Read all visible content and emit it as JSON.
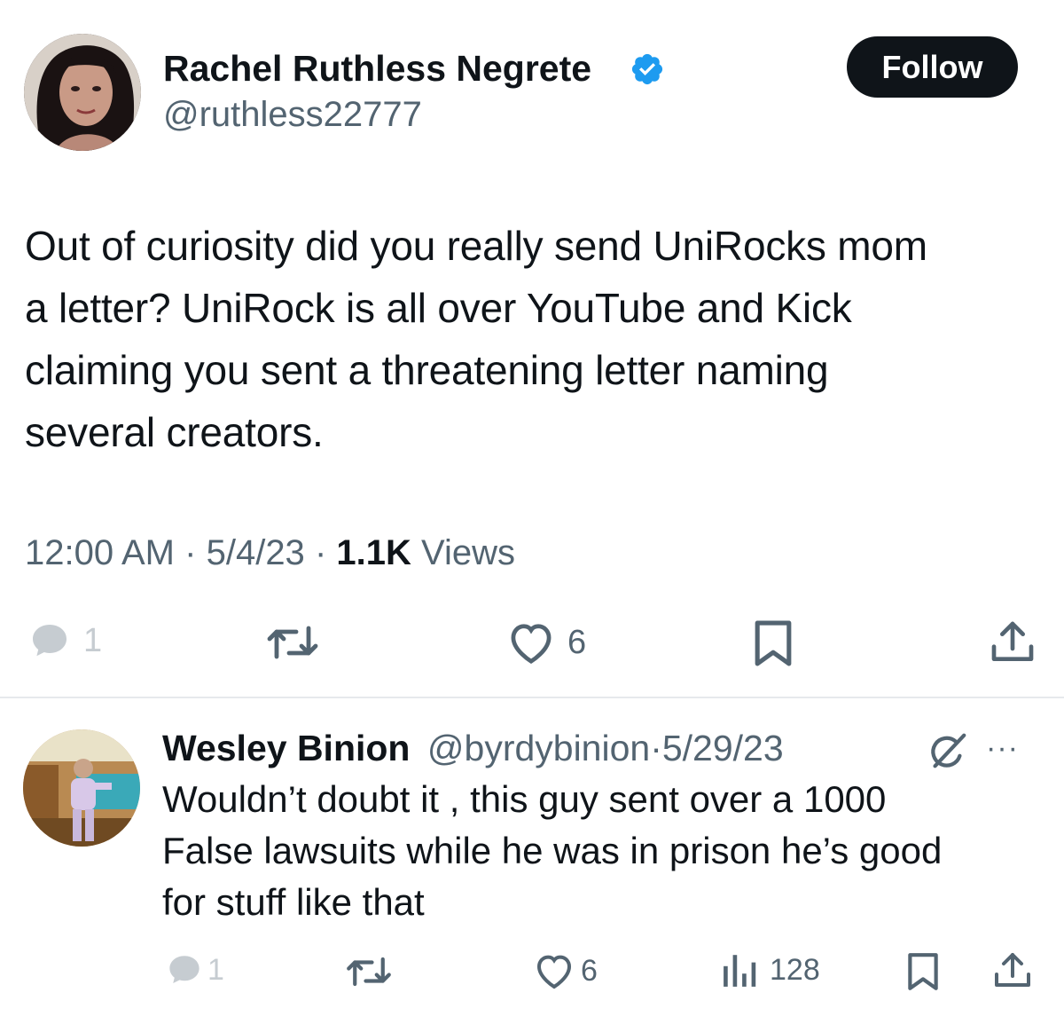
{
  "tweet": {
    "author_name": "Rachel Ruthless Negrete",
    "handle": "@ruthless22777",
    "follow_label": "Follow",
    "text_lines": [
      "Out of curiosity did you really send UniRocks mom",
      "a letter? UniRock is all over YouTube and Kick",
      "claiming you sent a threatening letter naming",
      "several creators."
    ],
    "time": "12:00 AM",
    "separator": "·",
    "date": "5/4/23",
    "views_count": "1.1K",
    "views_label": "Views",
    "replies": "1",
    "likes": "6"
  },
  "reply": {
    "author_name": "Wesley Binion",
    "handle": "@byrdybinion",
    "separator": "·",
    "date": "5/29/23",
    "more_label": "···",
    "text_lines": [
      "Wouldn’t doubt it , this guy sent over a 1000",
      "False lawsuits while he was in prison he’s good",
      "for stuff like that"
    ],
    "replies": "1",
    "likes": "6",
    "views": "128"
  },
  "colors": {
    "verified": "#1d9bf0",
    "text": "#0f1419",
    "muted": "#536471",
    "faded": "#c6ccd1",
    "divider": "#e6e9ec"
  },
  "icons": {
    "verified": "verified-badge-icon",
    "reply": "reply-bubble-icon",
    "retweet": "retweet-icon",
    "like": "heart-icon",
    "bookmark": "bookmark-icon",
    "share": "share-icon",
    "grok": "grok-slash-icon",
    "views": "bar-chart-icon"
  }
}
